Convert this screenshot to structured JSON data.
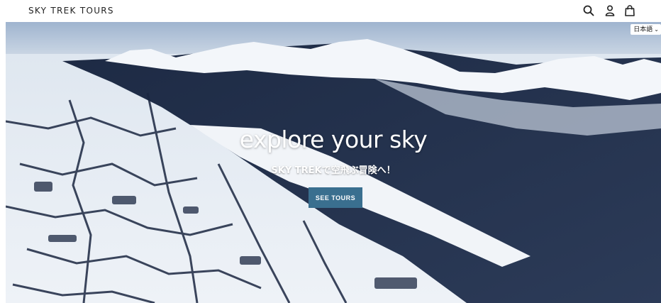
{
  "header": {
    "logo": "SKY TREK TOURS",
    "icons": [
      "search-icon",
      "account-icon",
      "cart-icon"
    ]
  },
  "language_selector": {
    "value": "日本語",
    "icon": "chevron-down-icon"
  },
  "hero": {
    "title": "explore your sky",
    "subtitle": "SKY TREKで空飛ぶ冒険へ！",
    "cta_label": "SEE TOURS",
    "cta_color": "#3a6f8f"
  }
}
